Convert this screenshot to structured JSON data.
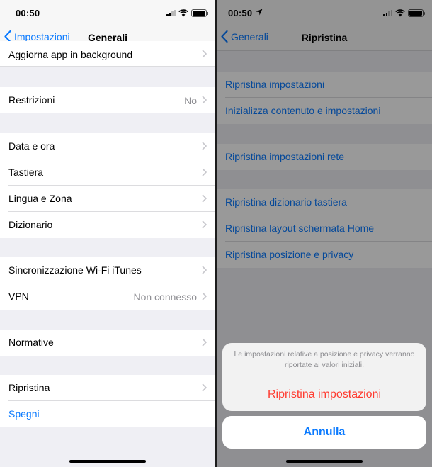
{
  "left": {
    "status": {
      "time": "00:50"
    },
    "nav": {
      "back_label": "Impostazioni",
      "title": "Generali"
    },
    "rows": {
      "aggiorna": {
        "label": "Aggiorna app in background"
      },
      "restrizioni": {
        "label": "Restrizioni",
        "value": "No"
      },
      "data_ora": {
        "label": "Data e ora"
      },
      "tastiera": {
        "label": "Tastiera"
      },
      "lingua": {
        "label": "Lingua e Zona"
      },
      "dizionario": {
        "label": "Dizionario"
      },
      "sync": {
        "label": "Sincronizzazione Wi-Fi iTunes"
      },
      "vpn": {
        "label": "VPN",
        "value": "Non connesso"
      },
      "normative": {
        "label": "Normative"
      },
      "ripristina": {
        "label": "Ripristina"
      },
      "spegni": {
        "label": "Spegni"
      }
    }
  },
  "right": {
    "status": {
      "time": "00:50"
    },
    "nav": {
      "back_label": "Generali",
      "title": "Ripristina"
    },
    "rows": {
      "imp": {
        "label": "Ripristina impostazioni"
      },
      "contenuto": {
        "label": "Inizializza contenuto e impostazioni"
      },
      "rete": {
        "label": "Ripristina impostazioni rete"
      },
      "dizionario": {
        "label": "Ripristina dizionario tastiera"
      },
      "layout": {
        "label": "Ripristina layout schermata Home"
      },
      "posizione": {
        "label": "Ripristina posizione e privacy"
      }
    },
    "action_sheet": {
      "message": "Le impostazioni relative a posizione e privacy verranno riportate ai valori iniziali.",
      "confirm_label": "Ripristina impostazioni",
      "cancel_label": "Annulla"
    }
  },
  "colors": {
    "accent": "#0a7aff",
    "destructive": "#ff3b30",
    "background": "#efeff4"
  }
}
